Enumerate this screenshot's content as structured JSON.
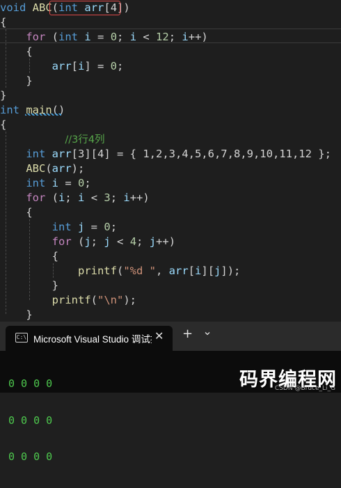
{
  "editor": {
    "lines": [
      {
        "tokens": [
          {
            "t": "void",
            "c": "kw"
          },
          {
            "t": " ",
            "c": "punc"
          },
          {
            "t": "ABC",
            "c": "fn"
          },
          {
            "t": "(",
            "c": "punc"
          },
          {
            "t": "int",
            "c": "kw"
          },
          {
            "t": " ",
            "c": "punc"
          },
          {
            "t": "arr",
            "c": "var"
          },
          {
            "t": "[4])",
            "c": "punc"
          }
        ]
      },
      {
        "tokens": [
          {
            "t": "{",
            "c": "punc"
          }
        ]
      },
      {
        "tokens": [
          {
            "t": "    ",
            "c": "punc"
          },
          {
            "t": "for",
            "c": "ctl"
          },
          {
            "t": " (",
            "c": "punc"
          },
          {
            "t": "int",
            "c": "kw"
          },
          {
            "t": " ",
            "c": "punc"
          },
          {
            "t": "i",
            "c": "var"
          },
          {
            "t": " = ",
            "c": "punc"
          },
          {
            "t": "0",
            "c": "num"
          },
          {
            "t": "; ",
            "c": "punc"
          },
          {
            "t": "i",
            "c": "var"
          },
          {
            "t": " < ",
            "c": "punc"
          },
          {
            "t": "12",
            "c": "num"
          },
          {
            "t": "; ",
            "c": "punc"
          },
          {
            "t": "i",
            "c": "var"
          },
          {
            "t": "++)",
            "c": "punc"
          }
        ]
      },
      {
        "tokens": [
          {
            "t": "    {",
            "c": "punc"
          }
        ]
      },
      {
        "tokens": [
          {
            "t": "        ",
            "c": "punc"
          },
          {
            "t": "arr",
            "c": "var"
          },
          {
            "t": "[",
            "c": "punc"
          },
          {
            "t": "i",
            "c": "var"
          },
          {
            "t": "] = ",
            "c": "punc"
          },
          {
            "t": "0",
            "c": "num"
          },
          {
            "t": ";",
            "c": "punc"
          }
        ]
      },
      {
        "tokens": [
          {
            "t": "    }",
            "c": "punc"
          }
        ]
      },
      {
        "tokens": [
          {
            "t": "}",
            "c": "punc"
          }
        ]
      },
      {
        "tokens": [
          {
            "t": "int",
            "c": "kw"
          },
          {
            "t": " ",
            "c": "punc"
          },
          {
            "t": "main",
            "c": "fn"
          },
          {
            "t": "()",
            "c": "punc"
          }
        ]
      },
      {
        "tokens": [
          {
            "t": "{",
            "c": "punc"
          }
        ]
      },
      {
        "tokens": [
          {
            "t": "          ",
            "c": "punc"
          },
          {
            "t": "//3行4列",
            "c": "cmt"
          }
        ]
      },
      {
        "tokens": [
          {
            "t": "    ",
            "c": "punc"
          },
          {
            "t": "int",
            "c": "kw"
          },
          {
            "t": " ",
            "c": "punc"
          },
          {
            "t": "arr",
            "c": "var"
          },
          {
            "t": "[3][4] = { 1,2,3,4,5,6,7,8,9,10,11,12 };",
            "c": "punc"
          }
        ]
      },
      {
        "tokens": [
          {
            "t": "    ",
            "c": "punc"
          },
          {
            "t": "ABC",
            "c": "fn"
          },
          {
            "t": "(",
            "c": "punc"
          },
          {
            "t": "arr",
            "c": "var"
          },
          {
            "t": ");",
            "c": "punc"
          }
        ]
      },
      {
        "tokens": [
          {
            "t": "    ",
            "c": "punc"
          },
          {
            "t": "int",
            "c": "kw"
          },
          {
            "t": " ",
            "c": "punc"
          },
          {
            "t": "i",
            "c": "var"
          },
          {
            "t": " = ",
            "c": "punc"
          },
          {
            "t": "0",
            "c": "num"
          },
          {
            "t": ";",
            "c": "punc"
          }
        ]
      },
      {
        "tokens": [
          {
            "t": "    ",
            "c": "punc"
          },
          {
            "t": "for",
            "c": "ctl"
          },
          {
            "t": " (",
            "c": "punc"
          },
          {
            "t": "i",
            "c": "var"
          },
          {
            "t": "; ",
            "c": "punc"
          },
          {
            "t": "i",
            "c": "var"
          },
          {
            "t": " < ",
            "c": "punc"
          },
          {
            "t": "3",
            "c": "num"
          },
          {
            "t": "; ",
            "c": "punc"
          },
          {
            "t": "i",
            "c": "var"
          },
          {
            "t": "++)",
            "c": "punc"
          }
        ]
      },
      {
        "tokens": [
          {
            "t": "    {",
            "c": "punc"
          }
        ]
      },
      {
        "tokens": [
          {
            "t": "        ",
            "c": "punc"
          },
          {
            "t": "int",
            "c": "kw"
          },
          {
            "t": " ",
            "c": "punc"
          },
          {
            "t": "j",
            "c": "var"
          },
          {
            "t": " = ",
            "c": "punc"
          },
          {
            "t": "0",
            "c": "num"
          },
          {
            "t": ";",
            "c": "punc"
          }
        ]
      },
      {
        "tokens": [
          {
            "t": "        ",
            "c": "punc"
          },
          {
            "t": "for",
            "c": "ctl"
          },
          {
            "t": " (",
            "c": "punc"
          },
          {
            "t": "j",
            "c": "var"
          },
          {
            "t": "; ",
            "c": "punc"
          },
          {
            "t": "j",
            "c": "var"
          },
          {
            "t": " < ",
            "c": "punc"
          },
          {
            "t": "4",
            "c": "num"
          },
          {
            "t": "; ",
            "c": "punc"
          },
          {
            "t": "j",
            "c": "var"
          },
          {
            "t": "++)",
            "c": "punc"
          }
        ]
      },
      {
        "tokens": [
          {
            "t": "        {",
            "c": "punc"
          }
        ]
      },
      {
        "tokens": [
          {
            "t": "            ",
            "c": "punc"
          },
          {
            "t": "printf",
            "c": "fn"
          },
          {
            "t": "(",
            "c": "punc"
          },
          {
            "t": "\"%d \"",
            "c": "str"
          },
          {
            "t": ", ",
            "c": "punc"
          },
          {
            "t": "arr",
            "c": "var"
          },
          {
            "t": "[",
            "c": "punc"
          },
          {
            "t": "i",
            "c": "var"
          },
          {
            "t": "][",
            "c": "punc"
          },
          {
            "t": "j",
            "c": "var"
          },
          {
            "t": "]);",
            "c": "punc"
          }
        ]
      },
      {
        "tokens": [
          {
            "t": "        }",
            "c": "punc"
          }
        ]
      },
      {
        "tokens": [
          {
            "t": "        ",
            "c": "punc"
          },
          {
            "t": "printf",
            "c": "fn"
          },
          {
            "t": "(",
            "c": "punc"
          },
          {
            "t": "\"\\n\"",
            "c": "str"
          },
          {
            "t": ");",
            "c": "punc"
          }
        ]
      },
      {
        "tokens": [
          {
            "t": "    }",
            "c": "punc"
          }
        ]
      }
    ]
  },
  "terminal": {
    "tab_title": "Microsoft Visual Studio 调试控制台",
    "icon": "terminal-icon",
    "close_glyph": "✕",
    "new_tab_glyph": "+",
    "output_lines": [
      "0 0 0 0",
      "0 0 0 0",
      "0 0 0 0"
    ]
  },
  "watermark": {
    "logo": "码界编程网",
    "small": "CSDN @Bruce_Li_G"
  },
  "colors": {
    "keyword": "#569cd6",
    "control": "#c586c0",
    "function": "#dcdcaa",
    "variable": "#9cdcfe",
    "number": "#b5cea8",
    "string": "#ce9178",
    "comment": "#57a64a",
    "terminal_text": "#4ec94e",
    "highlight_box": "#e04a4a"
  }
}
